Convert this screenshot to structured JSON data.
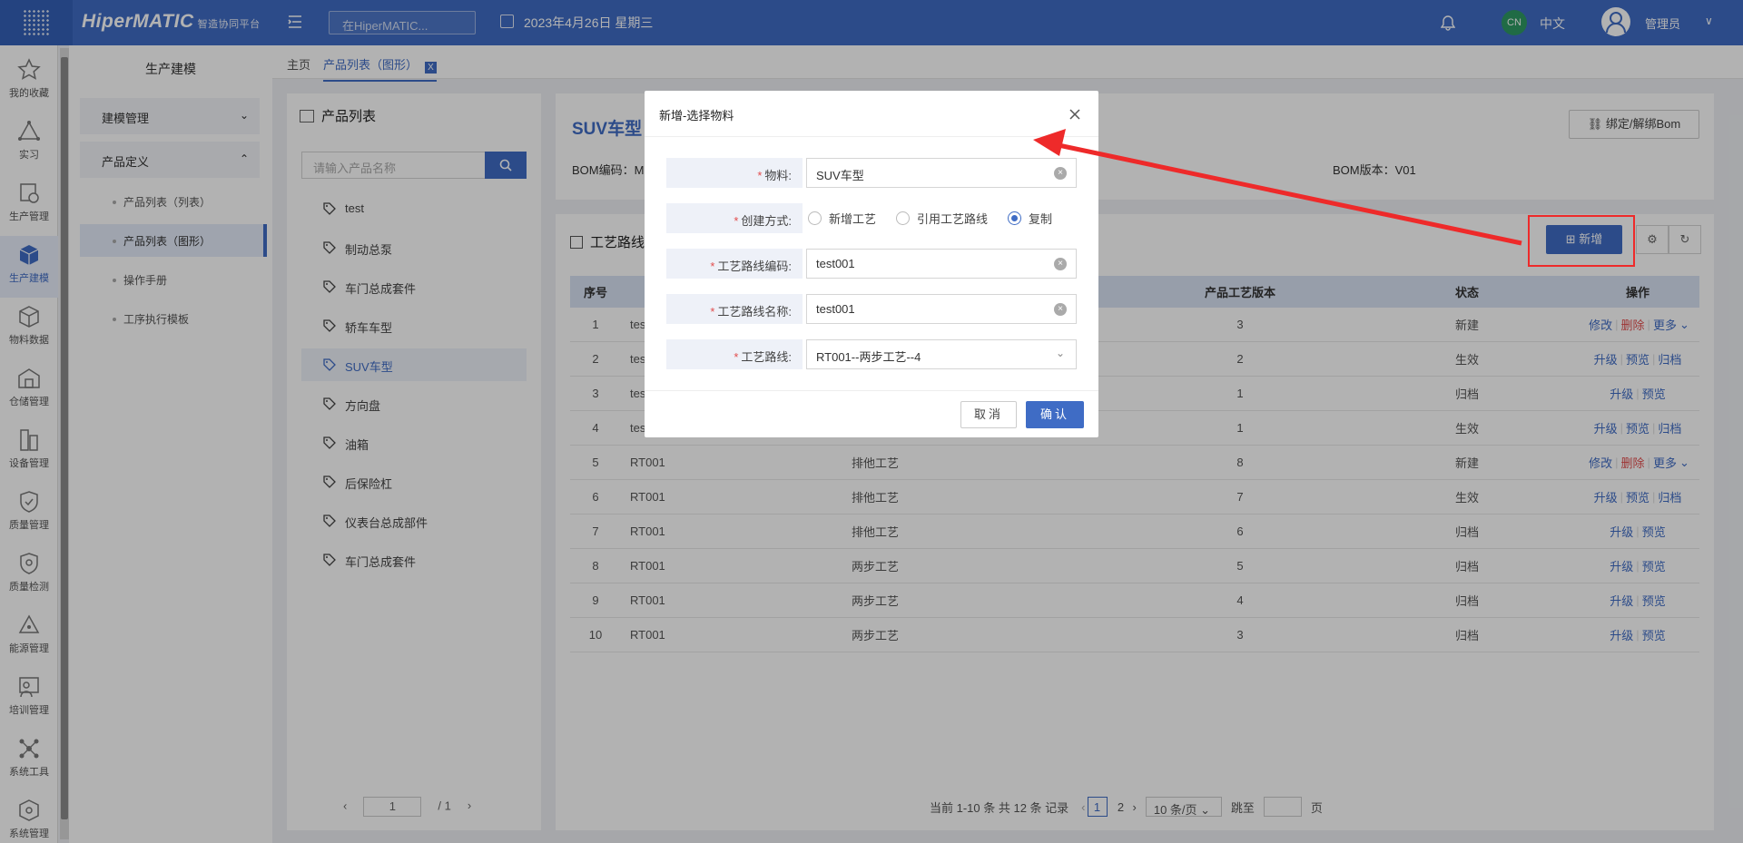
{
  "topbar": {
    "brand": "HiperMATIC",
    "brand_sub": "智造协同平台",
    "search_placeholder": "在HiperMATIC...",
    "date": "2023年4月26日 星期三",
    "lang_badge": "CN",
    "lang": "中文",
    "user": "管理员"
  },
  "sidebar": {
    "items": [
      {
        "label": "我的收藏",
        "icon": "star-icon"
      },
      {
        "label": "实习",
        "icon": "triangle-nodes-icon"
      },
      {
        "label": "生产管理",
        "icon": "production-icon"
      },
      {
        "label": "生产建模",
        "icon": "cube-icon"
      },
      {
        "label": "物料数据",
        "icon": "box-icon"
      },
      {
        "label": "仓储管理",
        "icon": "warehouse-icon"
      },
      {
        "label": "设备管理",
        "icon": "device-icon"
      },
      {
        "label": "质量管理",
        "icon": "shield-icon"
      },
      {
        "label": "质量检测",
        "icon": "shield-check-icon"
      },
      {
        "label": "能源管理",
        "icon": "energy-icon"
      },
      {
        "label": "培训管理",
        "icon": "training-icon"
      },
      {
        "label": "系统工具",
        "icon": "tools-icon"
      },
      {
        "label": "系统管理",
        "icon": "system-icon"
      }
    ]
  },
  "subnav": {
    "title": "生产建模",
    "groups": [
      {
        "label": "建模管理"
      },
      {
        "label": "产品定义"
      }
    ],
    "links": [
      {
        "label": "产品列表（列表）"
      },
      {
        "label": "产品列表（图形）"
      },
      {
        "label": "操作手册"
      },
      {
        "label": "工序执行模板"
      }
    ]
  },
  "tabs": {
    "home": "主页",
    "current": "产品列表（图形）",
    "close": "X"
  },
  "product_panel": {
    "title": "产品列表",
    "search_placeholder": "请输入产品名称",
    "items": [
      "test",
      "制动总泵",
      "车门总成套件",
      "轿车车型",
      "SUV车型",
      "方向盘",
      "油箱",
      "后保险杠",
      "仪表台总成部件",
      "车门总成套件"
    ],
    "page_current": "1",
    "page_total": "/ 1"
  },
  "detail": {
    "title": "SUV车型",
    "bom_code": "BOM编码：M",
    "bom_version": "BOM版本：V01",
    "bind_button": "绑定/解绑Bom"
  },
  "route_panel": {
    "title": "工艺路线",
    "add_button": "新增",
    "columns": [
      "序号",
      "",
      "",
      "产品工艺版本",
      "状态",
      "操作"
    ],
    "rows": [
      {
        "no": "1",
        "code": "test",
        "name": "",
        "ver": "3",
        "status": "新建",
        "ops": [
          "修改",
          "删除",
          "更多"
        ]
      },
      {
        "no": "2",
        "code": "test",
        "name": "",
        "ver": "2",
        "status": "生效",
        "ops": [
          "升级",
          "预览",
          "归档"
        ]
      },
      {
        "no": "3",
        "code": "test",
        "name": "",
        "ver": "1",
        "status": "归档",
        "ops": [
          "升级",
          "预览"
        ]
      },
      {
        "no": "4",
        "code": "test",
        "name": "",
        "ver": "1",
        "status": "生效",
        "ops": [
          "升级",
          "预览",
          "归档"
        ]
      },
      {
        "no": "5",
        "code": "RT001",
        "name": "排他工艺",
        "ver": "8",
        "status": "新建",
        "ops": [
          "修改",
          "删除",
          "更多"
        ]
      },
      {
        "no": "6",
        "code": "RT001",
        "name": "排他工艺",
        "ver": "7",
        "status": "生效",
        "ops": [
          "升级",
          "预览",
          "归档"
        ]
      },
      {
        "no": "7",
        "code": "RT001",
        "name": "排他工艺",
        "ver": "6",
        "status": "归档",
        "ops": [
          "升级",
          "预览"
        ]
      },
      {
        "no": "8",
        "code": "RT001",
        "name": "两步工艺",
        "ver": "5",
        "status": "归档",
        "ops": [
          "升级",
          "预览"
        ]
      },
      {
        "no": "9",
        "code": "RT001",
        "name": "两步工艺",
        "ver": "4",
        "status": "归档",
        "ops": [
          "升级",
          "预览"
        ]
      },
      {
        "no": "10",
        "code": "RT001",
        "name": "两步工艺",
        "ver": "3",
        "status": "归档",
        "ops": [
          "升级",
          "预览"
        ]
      }
    ],
    "pager": {
      "summary": "当前 1-10 条 共 12 条 记录",
      "pages": [
        "1",
        "2"
      ],
      "page_size": "10 条/页",
      "jump_label": "跳至",
      "page_suffix": "页"
    }
  },
  "modal": {
    "title": "新增-选择物料",
    "fields": {
      "material_label": "物料:",
      "material_value": "SUV车型",
      "mode_label": "创建方式:",
      "mode_options": [
        "新增工艺",
        "引用工艺路线",
        "复制"
      ],
      "mode_selected": "复制",
      "route_code_label": "工艺路线编码:",
      "route_code_value": "test001",
      "route_name_label": "工艺路线名称:",
      "route_name_value": "test001",
      "route_label": "工艺路线:",
      "route_value": "RT001--两步工艺--4"
    },
    "cancel": "取消",
    "ok": "确认"
  },
  "colors": {
    "primary": "#3f6cc5",
    "danger": "#e24d4d",
    "annotation": "#ee2a2a"
  }
}
